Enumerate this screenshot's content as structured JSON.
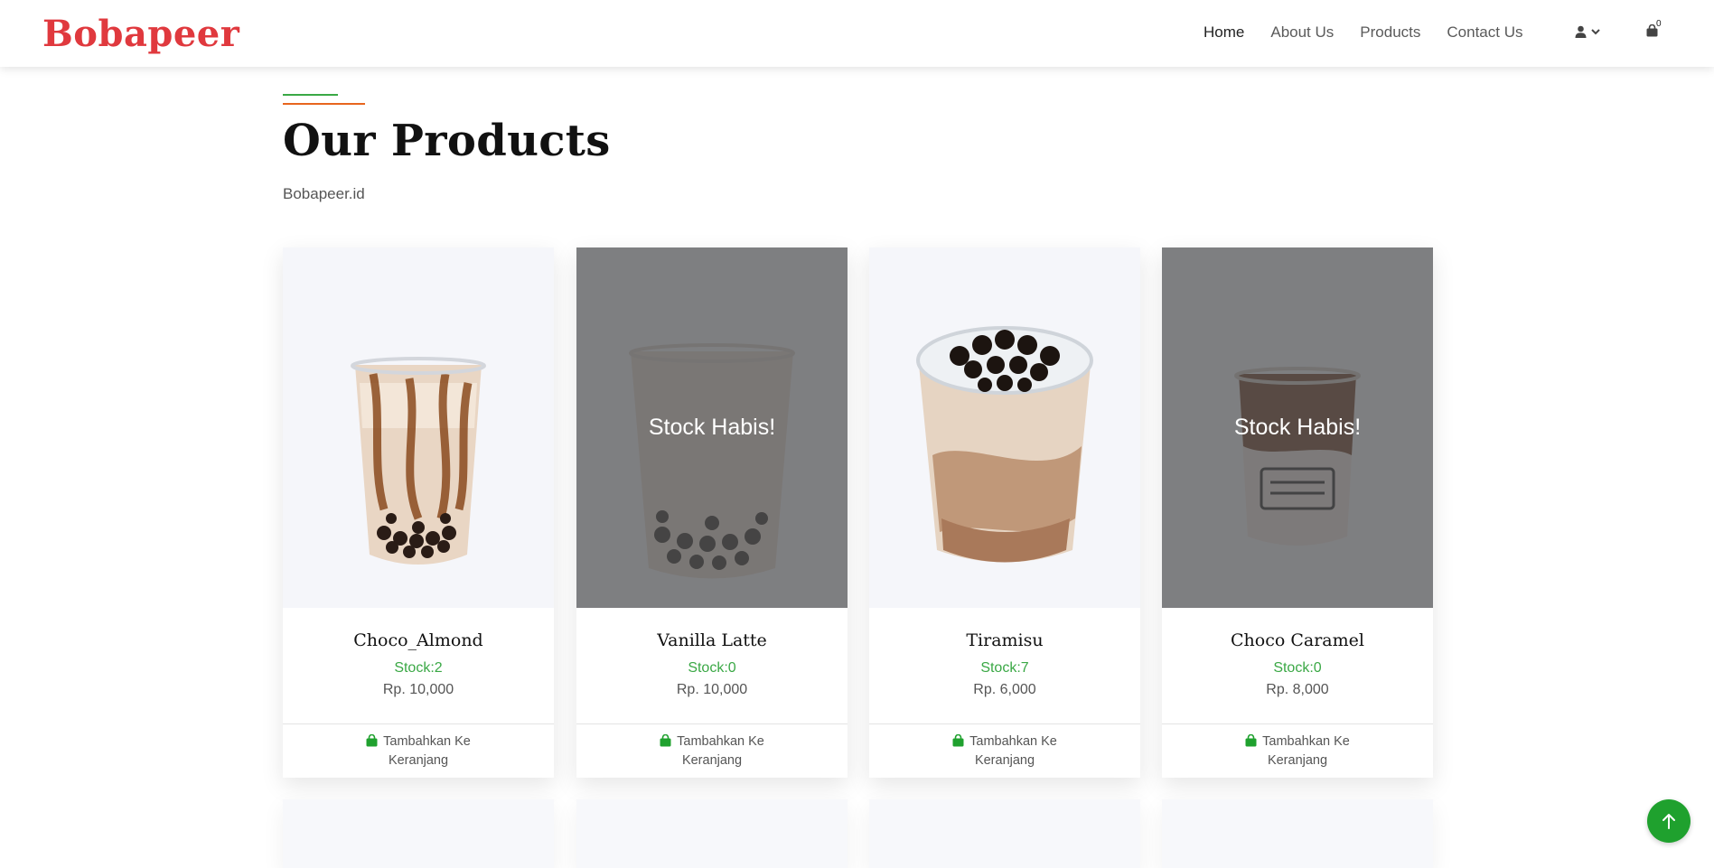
{
  "nav": {
    "brand": "Bobapeer",
    "links": [
      "Home",
      "About Us",
      "Products",
      "Contact Us"
    ],
    "cart_count": "0"
  },
  "header": {
    "title": "Our Products",
    "subtitle": "Bobapeer.id"
  },
  "products": [
    {
      "name": "Choco_Almond",
      "stock": "Stock:2",
      "price": "Rp. 10,000",
      "overlay": "",
      "button": [
        "Tambahkan Ke",
        "Keranjang"
      ]
    },
    {
      "name": "Vanilla Latte",
      "stock": "Stock:0",
      "price": "Rp. 10,000",
      "overlay": "Stock Habis!",
      "button": [
        "Tambahkan Ke",
        "Keranjang"
      ]
    },
    {
      "name": "Tiramisu",
      "stock": "Stock:7",
      "price": "Rp. 6,000",
      "overlay": "",
      "button": [
        "Tambahkan Ke",
        "Keranjang"
      ]
    },
    {
      "name": "Choco Caramel",
      "stock": "Stock:0",
      "price": "Rp. 8,000",
      "overlay": "Stock Habis!",
      "button": [
        "Tambahkan Ke",
        "Keranjang"
      ]
    }
  ],
  "icons": {
    "user": "user-icon",
    "dropdown": "chevron-down-icon",
    "cart": "shopping-bag-icon",
    "to_top": "arrow-up-icon"
  },
  "colors": {
    "brand_red": "#e0393e",
    "brand_orange": "#e86a2c",
    "stock_green": "#3aa845",
    "to_top_green": "#1fa12e"
  }
}
